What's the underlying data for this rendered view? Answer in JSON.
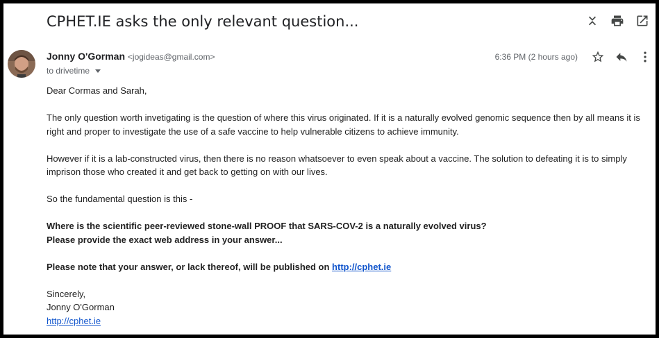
{
  "email": {
    "subject": "CPHET.IE asks the only relevant question...",
    "sender_name": "Jonny O'Gorman",
    "sender_email": "<jogideas@gmail.com>",
    "to_label": "to drivetime",
    "time": "6:36 PM (2 hours ago)",
    "body": {
      "greeting": "Dear Cormas and Sarah,",
      "p1": "The only question worth invetigating is the question of where this virus originated. If it is a naturally evolved genomic sequence then by all means it is right and proper to investigate the use of a safe vaccine to help vulnerable citizens to achieve immunity.",
      "p2": "However if it is a lab-constructed virus, then there is no reason whatsoever to even speak about a vaccine. The solution to defeating it is to simply imprison those who created it and get back to getting on with our lives.",
      "p3": "So the fundamental question is this -",
      "bold1": "Where is the scientific peer-reviewed stone-wall PROOF that SARS-COV-2 is a naturally evolved virus?",
      "bold2": "Please provide the exact web address in your answer...",
      "note_prefix": "Please note that your answer, or lack thereof,  will be published on ",
      "note_link": "http://cphet.ie",
      "signoff": "Sincerely,",
      "signature_name": "Jonny O'Gorman",
      "signature_link": "http://cphet.ie"
    }
  },
  "icons": {
    "collapse": "collapse-all-icon",
    "print": "print-icon",
    "popout": "open-in-new-window-icon",
    "star": "star-icon",
    "reply": "reply-icon",
    "more": "more-vertical-icon"
  }
}
